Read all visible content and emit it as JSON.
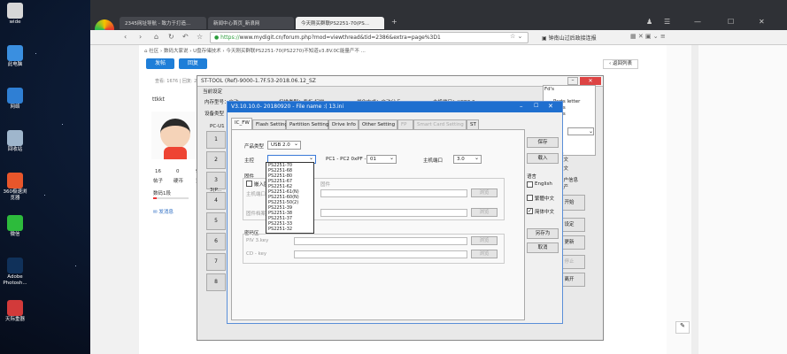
{
  "desktop": {
    "icons": [
      {
        "label": "wide",
        "color": "#d7d7d7"
      },
      {
        "label": "此电脑",
        "color": "#3a8fe0"
      },
      {
        "label": "网络",
        "color": "#2f7fd4"
      },
      {
        "label": "回收站",
        "color": "#9fb6cc"
      },
      {
        "label": "360极速浏览器",
        "color": "#e8562b"
      },
      {
        "label": "微信",
        "color": "#2dbb3c"
      },
      {
        "label": "Adobe Photosh...",
        "color": "#10315a"
      },
      {
        "label": "天际重器",
        "color": "#d23a3a"
      }
    ]
  },
  "browser": {
    "tabs": [
      {
        "label": "2345网址导航 - 致力于打造..."
      },
      {
        "label": "新闻中心首页_新浪网"
      },
      {
        "label": "今天刚买群联PS2251-70(PS..."
      }
    ],
    "url": {
      "protocol": "https://",
      "address": "www.mydigit.cn/forum.php?mod=viewthread&tid=2386&extra=page%3D1"
    },
    "bookmark": "钟南山过后政接连报",
    "breadcrumb": "社区 › 数码大家说 › U盘存储技术 › 今天刚买群联PS2251-70(PS2270)不知道v3.8V.0C能量产不 ...",
    "post_button": "发帖",
    "reply_button": "回复",
    "back_list": "返回列表",
    "views_label": "查看: 1676 | 回复: 23",
    "user": {
      "name": "ttkkt",
      "stats": [
        "16",
        "0",
        "9"
      ],
      "stat_labels": [
        "帖子",
        "硬币",
        "注"
      ],
      "rank": "数码1段",
      "message": "发消息"
    }
  },
  "sttool": {
    "title": "ST-TOOL (Ref)-9000-1.7F.53-2018.06.12_SZ",
    "section": "当前设定",
    "info": [
      {
        "label": "内存型号：自动"
      },
      {
        "label": "扫描类型：看板 扫描"
      },
      {
        "label": "优化方式：自动分点"
      },
      {
        "label": "主机端口：USB3.0"
      }
    ],
    "device_label": "设备类型",
    "port_label": "PC-U1",
    "row_nums": [
      "1",
      "2",
      "3",
      "4",
      "5",
      "6",
      "7",
      "8"
    ],
    "center_text": "3(P..."
  },
  "dialog": {
    "title": "V3.10.10.0- 20180920 - File name :( 13.ini",
    "tabs": [
      "IC_FW",
      "Flash Setting",
      "Partition Setting",
      "Drive Info",
      "Other Setting",
      "FP",
      "Smart Card Setting",
      "ST"
    ],
    "product_label": "产品类型",
    "product_value": "USB 2.0",
    "controller_label": "主控",
    "controller_value": "",
    "pc_label": "PC1 - PC2 0xPF -",
    "pc_value": "01",
    "host_label": "主机端口",
    "host_value": "3.0",
    "firmware_label": "固件",
    "embed_label": "嵌入固件",
    "embed_suffix": "固件",
    "main_file_label": "主机端口",
    "fw_file_label": "固件档案",
    "password_label": "密码区",
    "pwd_key1": "PIV 3.key",
    "pwd_key2": "CD - key",
    "browse": "浏览",
    "dropdown_options": [
      "PS2251-70",
      "PS2251-68",
      "PS2251-80",
      "PS2251-67",
      "PS2251-62",
      "PS2251-61(N)",
      "PS2251-60(N)",
      "PS2251-50(2)",
      "PS2251-39",
      "PS2251-38",
      "PS2251-37",
      "PS2251-33",
      "PS2251-32"
    ],
    "side_buttons": [
      "保存",
      "载入",
      "另存为",
      "取消"
    ],
    "language_label": "语言",
    "languages": [
      "English",
      "繁體中文",
      "简体中文"
    ],
    "language_checked": [
      false,
      false,
      true
    ]
  },
  "side": {
    "items": [
      "Fd's",
      "Parts letter",
      "Ports",
      "Ports"
    ],
    "labels": [
      "品",
      "中文",
      "中文",
      "用户信息",
      "量产"
    ],
    "buttons": [
      "开始",
      "设定",
      "更新",
      "停止",
      "离开"
    ]
  }
}
